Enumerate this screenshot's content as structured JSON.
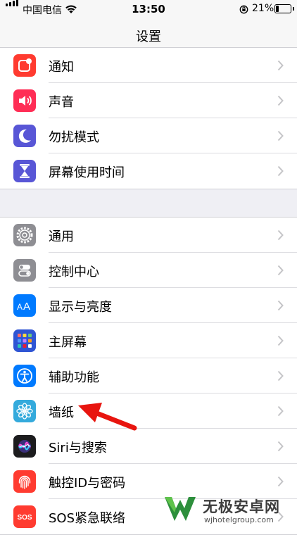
{
  "status_bar": {
    "carrier": "中国电信",
    "time": "13:50",
    "battery_percent": "21%",
    "battery_level": 0.21
  },
  "nav": {
    "title": "设置"
  },
  "groups": [
    {
      "items": [
        {
          "label": "通知",
          "icon": "notification-icon",
          "color": "#ff3b30"
        },
        {
          "label": "声音",
          "icon": "sound-icon",
          "color": "#ff2d55"
        },
        {
          "label": "勿扰模式",
          "icon": "moon-icon",
          "color": "#5856d6"
        },
        {
          "label": "屏幕使用时间",
          "icon": "hourglass-icon",
          "color": "#5856d6"
        }
      ]
    },
    {
      "items": [
        {
          "label": "通用",
          "icon": "gear-icon",
          "color": "#8e8e93"
        },
        {
          "label": "控制中心",
          "icon": "toggles-icon",
          "color": "#8e8e93"
        },
        {
          "label": "显示与亮度",
          "icon": "text-size-icon",
          "color": "#007aff"
        },
        {
          "label": "主屏幕",
          "icon": "home-screen-icon",
          "color": "#2f55d4"
        },
        {
          "label": "辅助功能",
          "icon": "accessibility-icon",
          "color": "#007aff"
        },
        {
          "label": "墙纸",
          "icon": "wallpaper-flower-icon",
          "color": "#34aadc"
        },
        {
          "label": "Siri与搜索",
          "icon": "siri-icon",
          "color": "#1c1c1e"
        },
        {
          "label": "触控ID与密码",
          "icon": "fingerprint-icon",
          "color": "#ff3b30"
        },
        {
          "label": "SOS紧急联络",
          "icon": "sos-icon",
          "color": "#ff3b30"
        }
      ]
    }
  ],
  "watermark": {
    "title": "无极安卓网",
    "url": "wjhotelgroup.com"
  }
}
